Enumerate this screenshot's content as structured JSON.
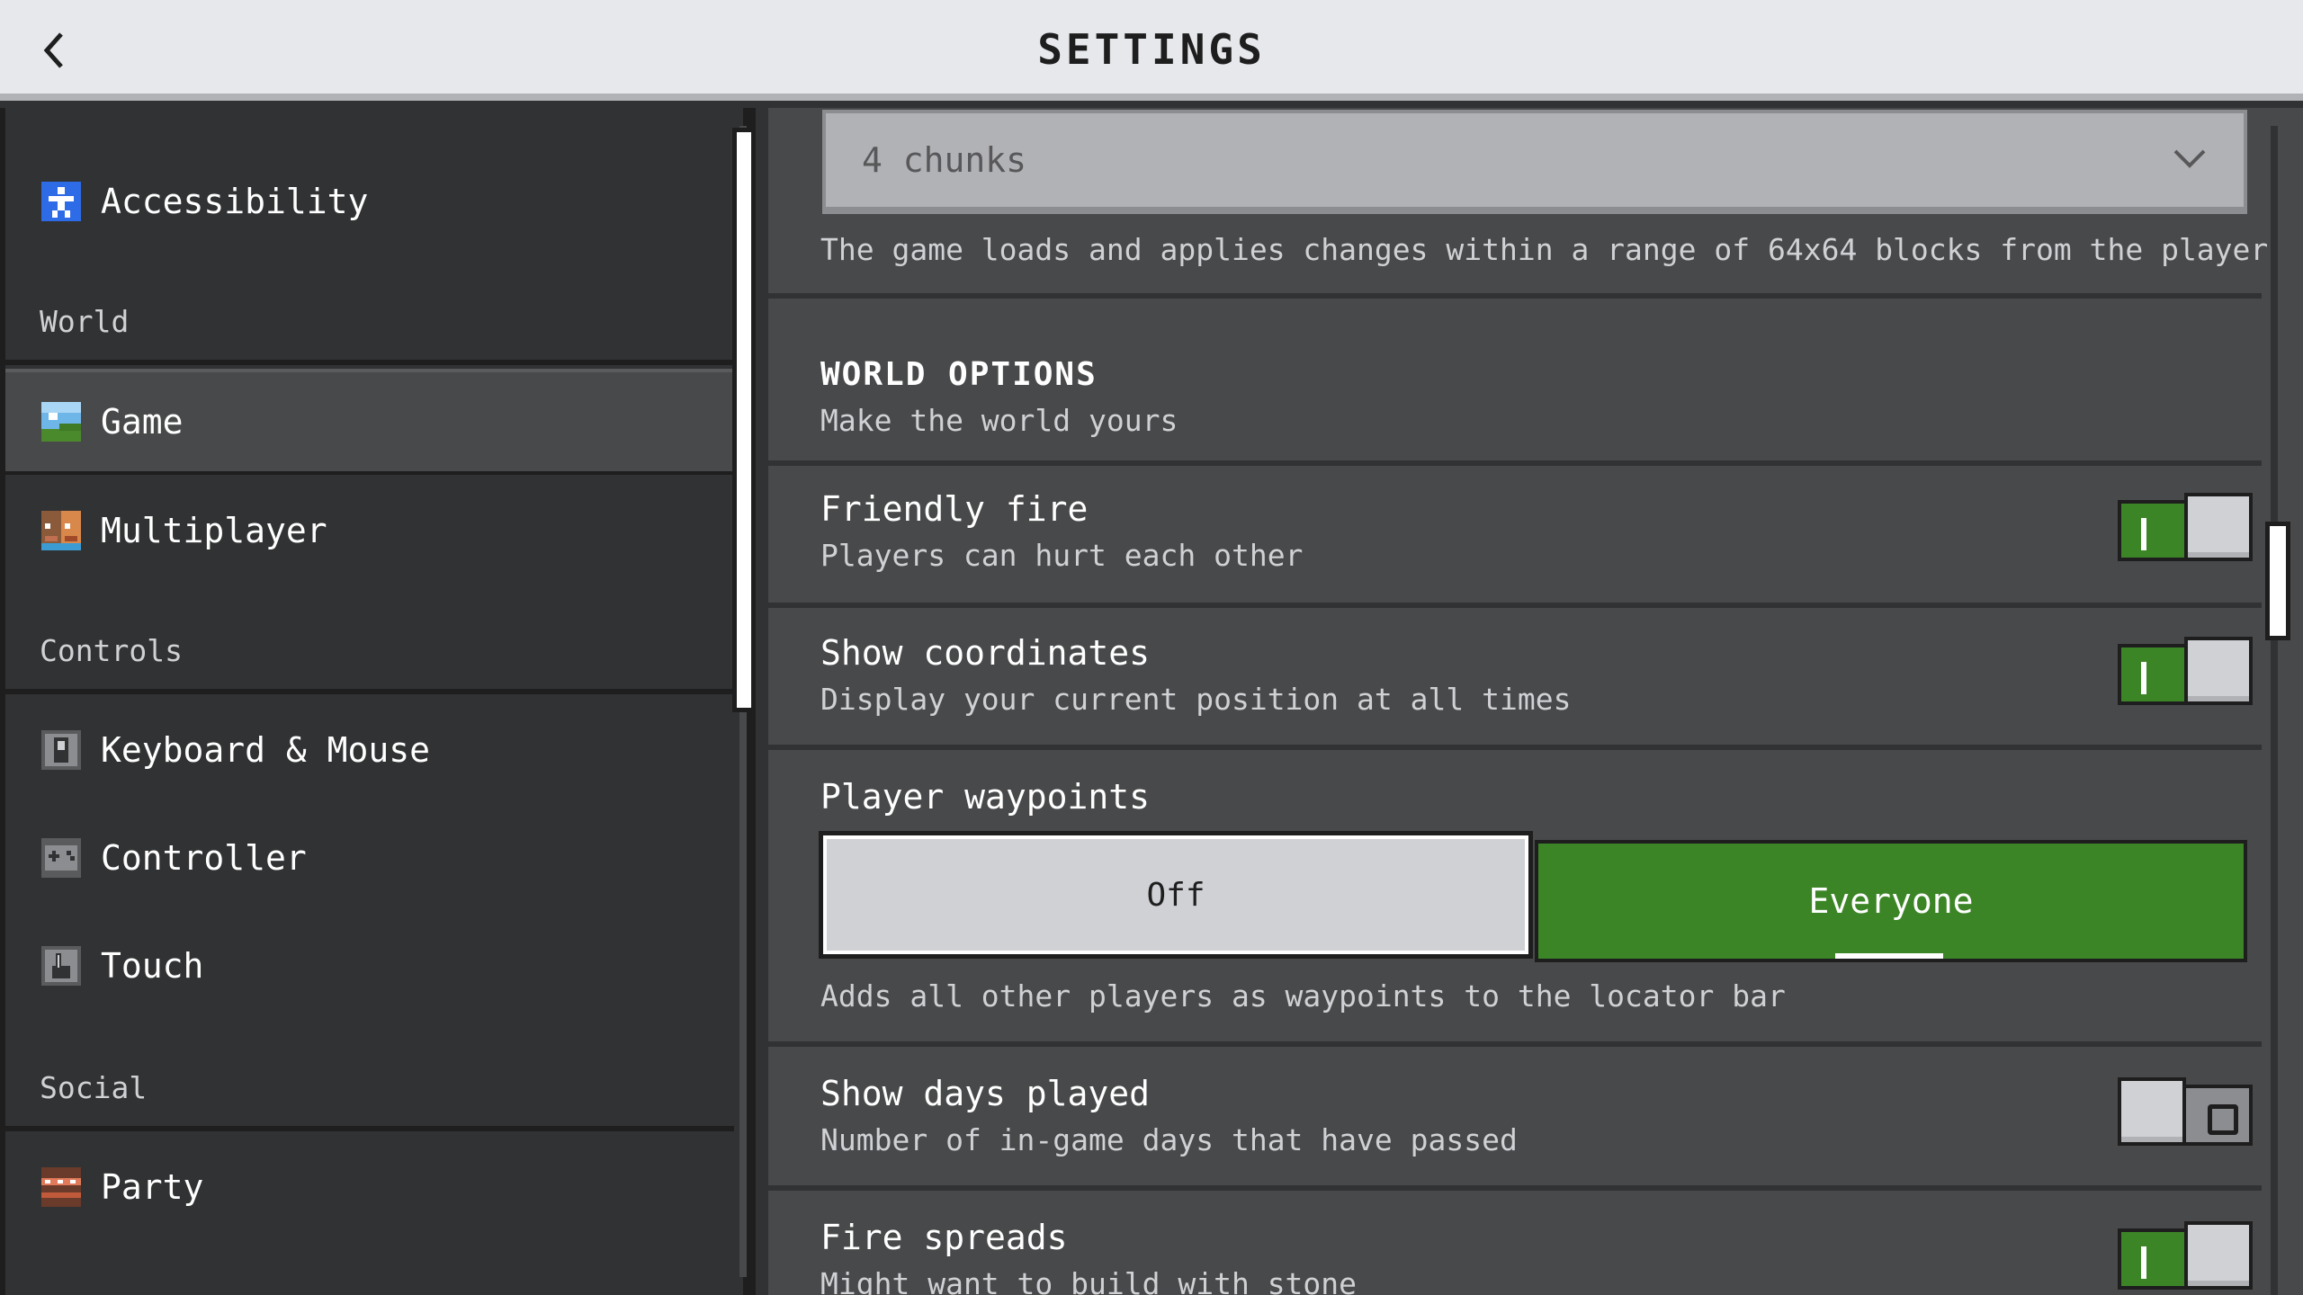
{
  "header": {
    "title": "SETTINGS",
    "back_icon": "chevron-left-icon"
  },
  "sidebar": {
    "items": [
      {
        "label": "Accessibility",
        "icon": "accessibility-icon"
      },
      {
        "label": "Game",
        "icon": "game-landscape-icon",
        "selected": true
      },
      {
        "label": "Multiplayer",
        "icon": "multiplayer-icon"
      },
      {
        "label": "Keyboard & Mouse",
        "icon": "keyboard-mouse-icon"
      },
      {
        "label": "Controller",
        "icon": "controller-icon"
      },
      {
        "label": "Touch",
        "icon": "touch-icon"
      },
      {
        "label": "Party",
        "icon": "party-icon"
      }
    ],
    "sections": {
      "world": "World",
      "controls": "Controls",
      "social": "Social"
    }
  },
  "main": {
    "render_distance": {
      "value": "4 chunks",
      "description": "The game loads and applies changes within a range of 64x64 blocks from the player"
    },
    "world_options": {
      "title": "WORLD OPTIONS",
      "subtitle": "Make the world yours"
    },
    "friendly_fire": {
      "title": "Friendly fire",
      "description": "Players can hurt each other",
      "enabled": true
    },
    "show_coordinates": {
      "title": "Show coordinates",
      "description": "Display your current position at all times",
      "enabled": true
    },
    "player_waypoints": {
      "title": "Player waypoints",
      "options": [
        "Off",
        "Everyone"
      ],
      "selected": "Everyone",
      "description": "Adds all other players as waypoints to the locator bar"
    },
    "show_days_played": {
      "title": "Show days played",
      "description": "Number of in-game days that have passed",
      "enabled": false
    },
    "fire_spreads": {
      "title": "Fire spreads",
      "description": "Might want to build with stone",
      "enabled": true
    }
  },
  "colors": {
    "accent_green": "#3c8527",
    "panel_dark": "#313233",
    "panel": "#48494a",
    "header_bg": "#e6e8eb"
  }
}
